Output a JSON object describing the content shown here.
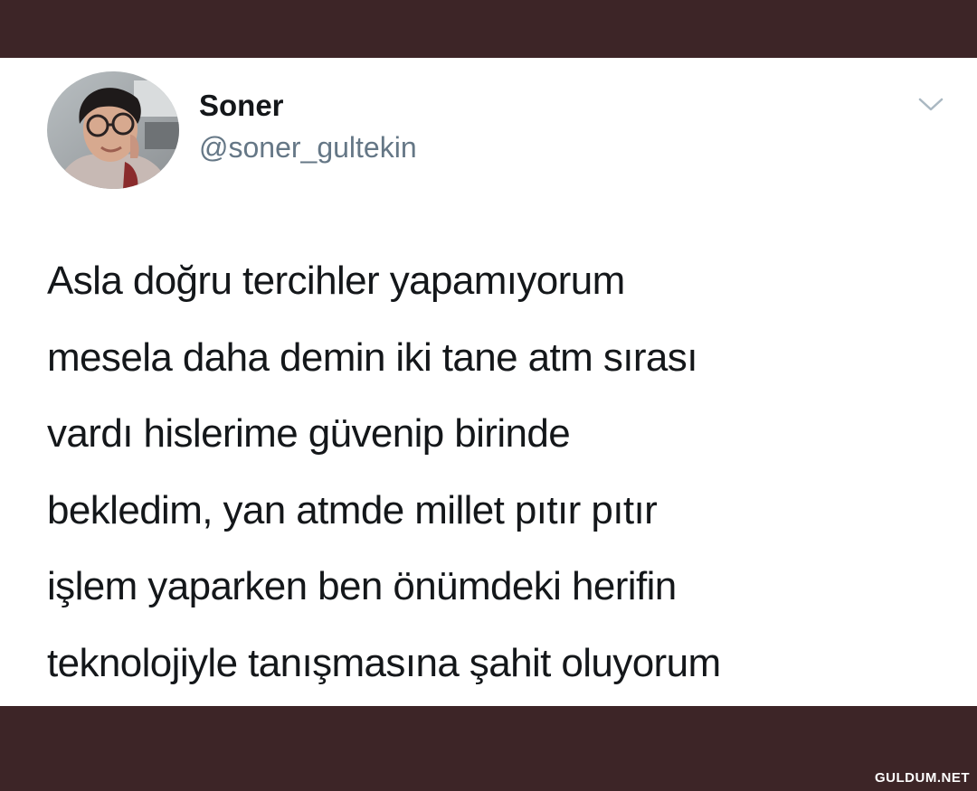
{
  "tweet": {
    "display_name": "Soner",
    "handle": "@soner_gultekin",
    "text_lines": [
      "Asla doğru tercihler yapamıyorum",
      "mesela daha demin iki tane atm sırası",
      "vardı hislerime güvenip birinde",
      "bekledim, yan atmde millet pıtır pıtır",
      "işlem yaparken ben önümdeki herifin",
      "teknolojiyle tanışmasına şahit oluyorum"
    ]
  },
  "icons": {
    "menu": "chevron-down-icon",
    "avatar": "avatar-photo"
  },
  "colors": {
    "frame": "#3d2527",
    "card": "#ffffff",
    "text": "#14171a",
    "handle": "#657786"
  },
  "watermark": "GULDUM.NET"
}
